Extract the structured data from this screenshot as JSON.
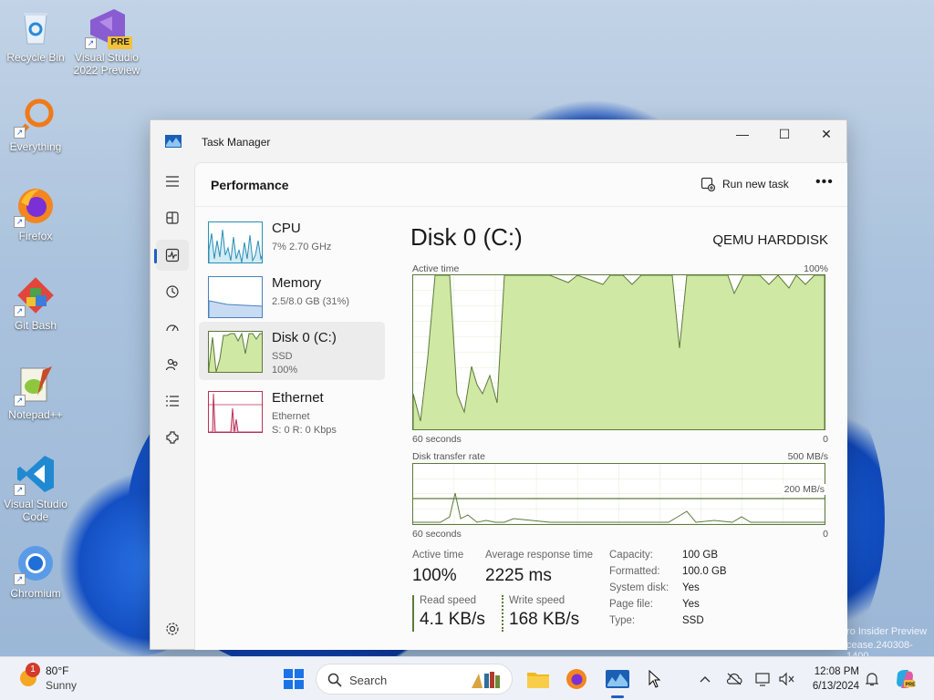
{
  "desktop": {
    "icons": [
      {
        "label": "Recycle Bin"
      },
      {
        "label": "Visual Studio 2022 Preview",
        "badge": "PRE"
      },
      {
        "label": "Everything"
      },
      {
        "label": "Firefox"
      },
      {
        "label": "Git Bash"
      },
      {
        "label": "Notepad++"
      },
      {
        "label": "Visual Studio Code"
      },
      {
        "label": "Chromium"
      }
    ],
    "watermark_line1": "ro Insider Preview",
    "watermark_line2": "cease.240308-1400"
  },
  "window": {
    "title": "Task Manager",
    "controls": {
      "minimize": "—",
      "maximize": "☐",
      "close": "✕"
    },
    "nav_icons": [
      "hamburger-icon",
      "processes-icon",
      "performance-icon",
      "app-history-icon",
      "startup-apps-icon",
      "users-icon",
      "details-icon",
      "services-icon",
      "settings-icon"
    ],
    "page_title": "Performance",
    "run_new_task": "Run new task",
    "more": "•••"
  },
  "devices": [
    {
      "name": "CPU",
      "sub1": "7% 2.70 GHz",
      "sub2": ""
    },
    {
      "name": "Memory",
      "sub1": "2.5/8.0 GB (31%)",
      "sub2": ""
    },
    {
      "name": "Disk 0 (C:)",
      "sub1": "SSD",
      "sub2": "100%"
    },
    {
      "name": "Ethernet",
      "sub1": "Ethernet",
      "sub2": "S: 0 R: 0 Kbps"
    }
  ],
  "disk": {
    "title": "Disk 0 (C:)",
    "model": "QEMU HARDDISK",
    "active_time_label": "Active time",
    "active_time_max": "100%",
    "x_left": "60 seconds",
    "x_right": "0",
    "transfer_label": "Disk transfer rate",
    "transfer_max": "500 MB/s",
    "transfer_line_label": "200 MB/s",
    "stats": {
      "active_time": {
        "label": "Active time",
        "value": "100%"
      },
      "avg_response": {
        "label": "Average response time",
        "value": "2225 ms"
      },
      "read_speed": {
        "label": "Read speed",
        "value": "4.1 KB/s"
      },
      "write_speed": {
        "label": "Write speed",
        "value": "168 KB/s"
      }
    },
    "props": [
      {
        "k": "Capacity:",
        "v": "100 GB"
      },
      {
        "k": "Formatted:",
        "v": "100.0 GB"
      },
      {
        "k": "System disk:",
        "v": "Yes"
      },
      {
        "k": "Page file:",
        "v": "Yes"
      },
      {
        "k": "Type:",
        "v": "SSD"
      }
    ]
  },
  "taskbar": {
    "weather_temp": "80°F",
    "weather_cond": "Sunny",
    "weather_badge": "1",
    "search_placeholder": "Search",
    "time": "12:08 PM",
    "date": "6/13/2024"
  },
  "colors": {
    "accent": "#1f5fbf",
    "disk_fill": "#cfe8a4",
    "disk_line": "#5d7a3a",
    "cpu_line": "#2a8fb5",
    "memory_fill": "#c7dcf2",
    "ethernet_line": "#b9325a"
  }
}
